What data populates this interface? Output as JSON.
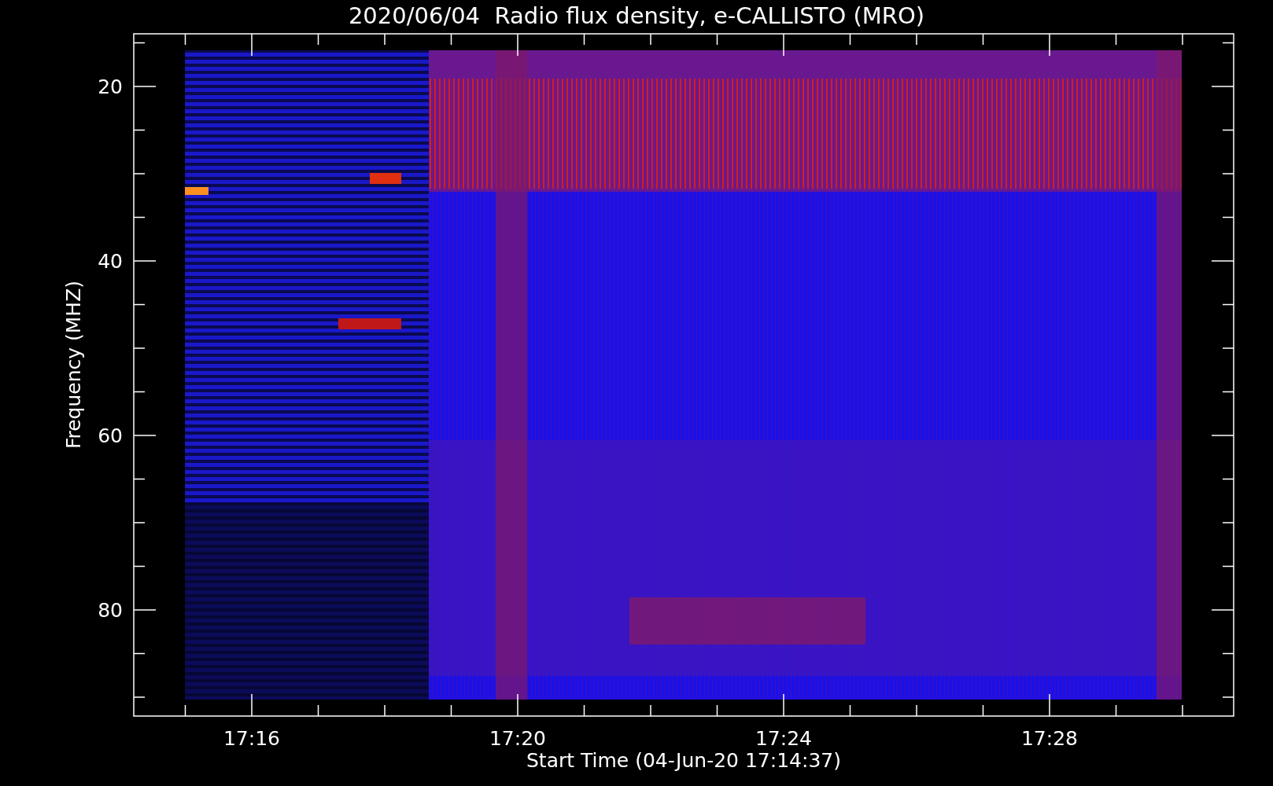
{
  "title": "2020/06/04  Radio flux density, e-CALLISTO (MRO)",
  "y_axis": {
    "label": "Frequency (MHZ)",
    "ticks": [
      "20",
      "40",
      "60",
      "80"
    ]
  },
  "x_axis": {
    "label": "Start Time (04-Jun-20 17:14:37)",
    "ticks": [
      "17:16",
      "17:20",
      "17:24",
      "17:28"
    ]
  }
}
